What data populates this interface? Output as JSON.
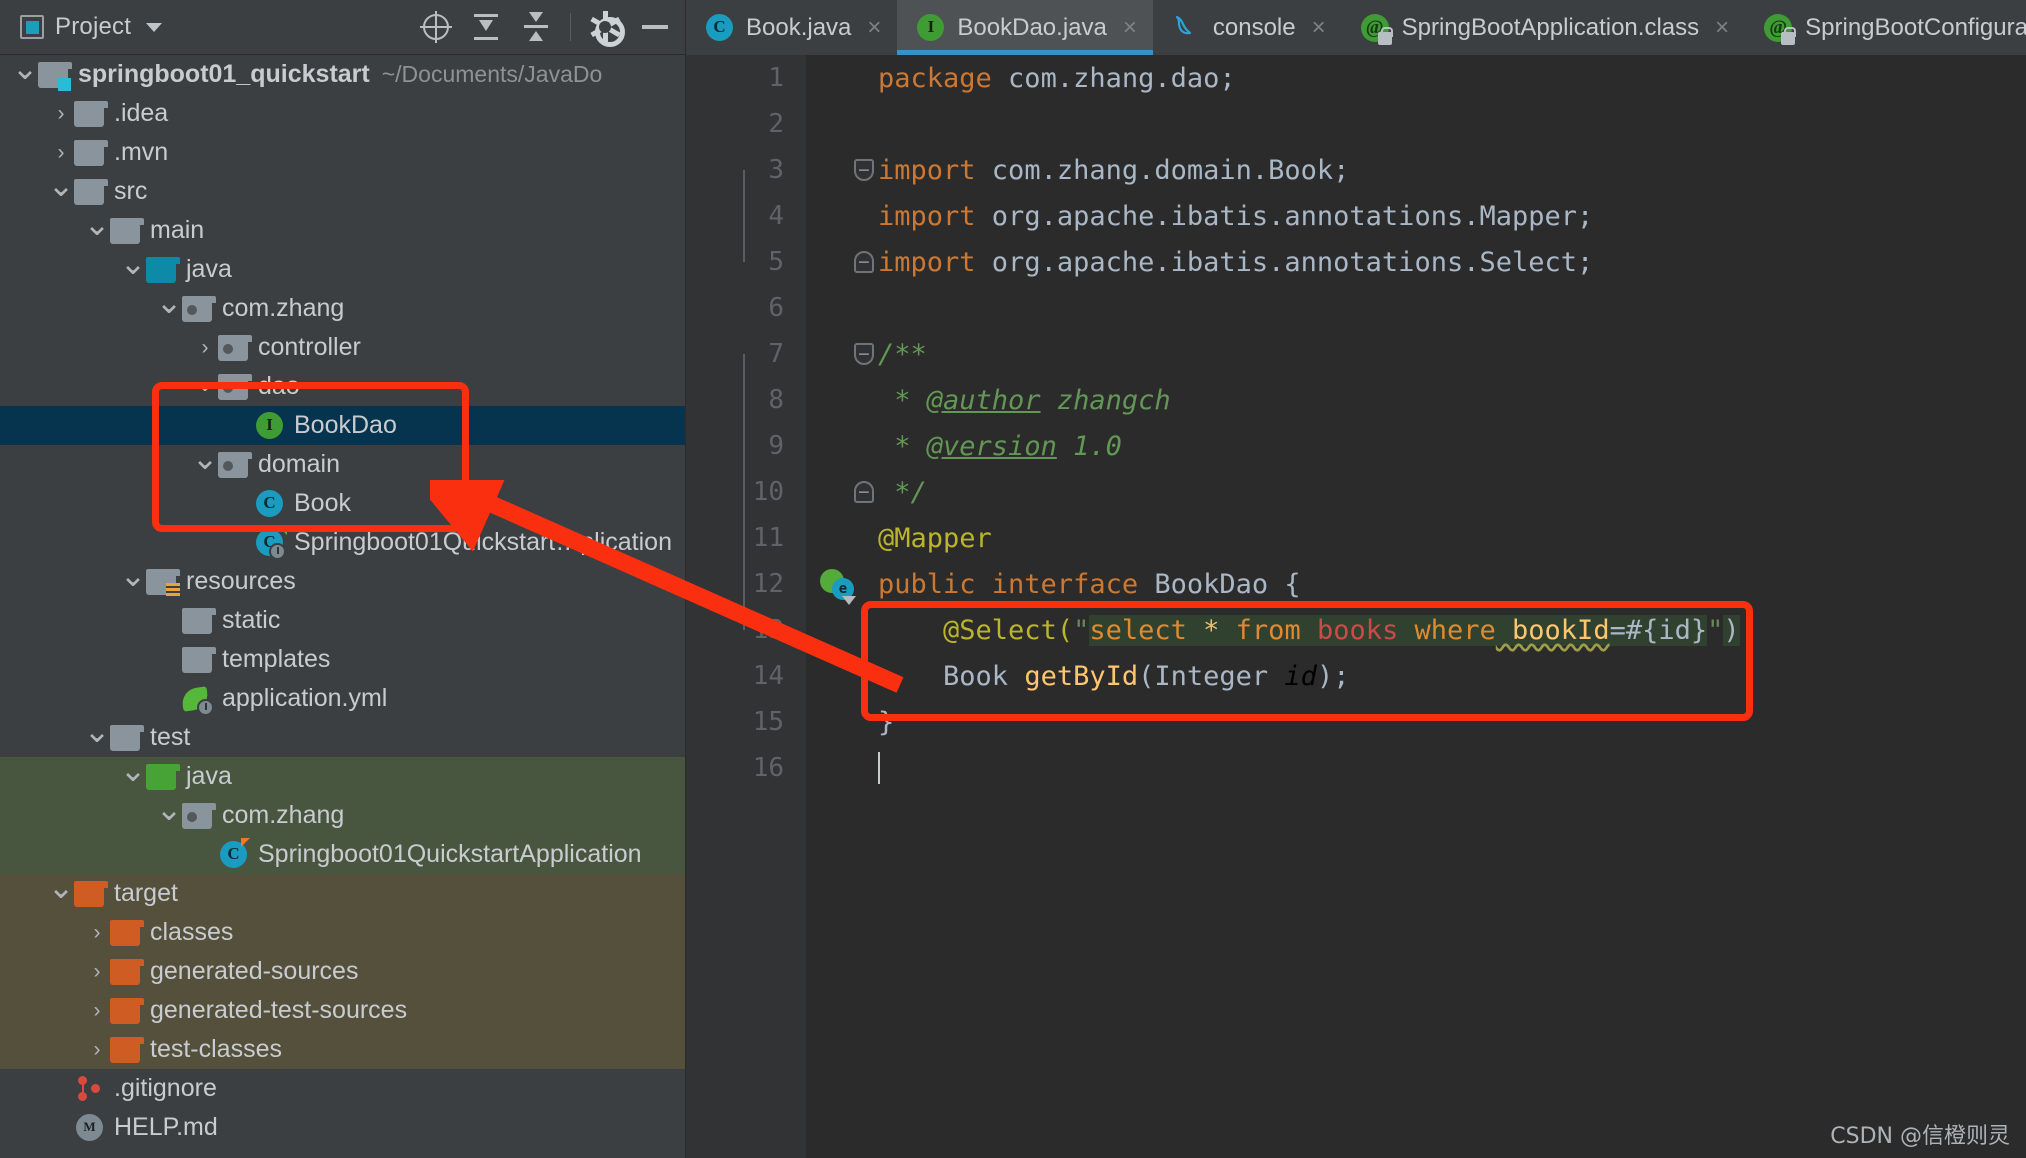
{
  "project_panel": {
    "title": "Project",
    "icons": {
      "dropdown": "chevron-down-icon",
      "locate": "locate-icon",
      "expand_all": "expand-all-icon",
      "collapse_all": "collapse-all-icon",
      "settings": "gear-icon",
      "hide": "minimize-icon"
    },
    "tree": [
      {
        "label": "springboot01_quickstart",
        "suffix": "~/Documents/JavaDo",
        "indent": 0,
        "arrow": "down",
        "icon": "module-folder",
        "bold": true
      },
      {
        "label": ".idea",
        "indent": 1,
        "arrow": "right",
        "icon": "folder"
      },
      {
        "label": ".mvn",
        "indent": 1,
        "arrow": "right",
        "icon": "folder"
      },
      {
        "label": "src",
        "indent": 1,
        "arrow": "down",
        "icon": "folder"
      },
      {
        "label": "main",
        "indent": 2,
        "arrow": "down",
        "icon": "folder"
      },
      {
        "label": "java",
        "indent": 3,
        "arrow": "down",
        "icon": "source-root-folder"
      },
      {
        "label": "com.zhang",
        "indent": 4,
        "arrow": "down",
        "icon": "package-folder"
      },
      {
        "label": "controller",
        "indent": 5,
        "arrow": "right",
        "icon": "package-folder"
      },
      {
        "label": "dao",
        "indent": 5,
        "arrow": "down",
        "icon": "package-folder"
      },
      {
        "label": "BookDao",
        "indent": 6,
        "arrow": "none",
        "icon": "interface-file",
        "selected": true
      },
      {
        "label": "domain",
        "indent": 5,
        "arrow": "down",
        "icon": "package-folder"
      },
      {
        "label": "Book",
        "indent": 6,
        "arrow": "none",
        "icon": "class-file"
      },
      {
        "label": "Springboot01Quickstart…plication",
        "indent": 6,
        "arrow": "none",
        "icon": "spring-boot-class-file"
      },
      {
        "label": "resources",
        "indent": 3,
        "arrow": "down",
        "icon": "resource-folder"
      },
      {
        "label": "static",
        "indent": 4,
        "arrow": "none",
        "icon": "folder"
      },
      {
        "label": "templates",
        "indent": 4,
        "arrow": "none",
        "icon": "folder"
      },
      {
        "label": "application.yml",
        "indent": 4,
        "arrow": "none",
        "icon": "spring-yaml-file"
      },
      {
        "label": "test",
        "indent": 2,
        "arrow": "down",
        "icon": "folder"
      },
      {
        "label": "java",
        "indent": 3,
        "arrow": "down",
        "icon": "test-source-root-folder",
        "rowbg": "test"
      },
      {
        "label": "com.zhang",
        "indent": 4,
        "arrow": "down",
        "icon": "package-folder",
        "rowbg": "test"
      },
      {
        "label": "Springboot01QuickstartApplication",
        "indent": 5,
        "arrow": "none",
        "icon": "test-class-file",
        "rowbg": "test"
      },
      {
        "label": "target",
        "indent": 1,
        "arrow": "down",
        "icon": "excluded-folder",
        "rowbg": "target"
      },
      {
        "label": "classes",
        "indent": 2,
        "arrow": "right",
        "icon": "excluded-folder",
        "rowbg": "target"
      },
      {
        "label": "generated-sources",
        "indent": 2,
        "arrow": "right",
        "icon": "excluded-folder",
        "rowbg": "target"
      },
      {
        "label": "generated-test-sources",
        "indent": 2,
        "arrow": "right",
        "icon": "excluded-folder",
        "rowbg": "target"
      },
      {
        "label": "test-classes",
        "indent": 2,
        "arrow": "right",
        "icon": "excluded-folder",
        "rowbg": "target"
      },
      {
        "label": ".gitignore",
        "indent": 1,
        "arrow": "none",
        "icon": "gitignore-file"
      },
      {
        "label": "HELP.md",
        "indent": 1,
        "arrow": "none",
        "icon": "markdown-file"
      }
    ]
  },
  "editor": {
    "tabs": [
      {
        "label": "Book.java",
        "icon": "class-file",
        "active": false,
        "closeable": true
      },
      {
        "label": "BookDao.java",
        "icon": "interface-file",
        "active": true,
        "closeable": true
      },
      {
        "label": "console",
        "icon": "mysql-dolphin-icon",
        "active": false,
        "closeable": true
      },
      {
        "label": "SpringBootApplication.class",
        "icon": "annotation-readonly-file",
        "active": false,
        "closeable": true
      },
      {
        "label": "SpringBootConfiguratio",
        "icon": "annotation-readonly-file",
        "active": false,
        "closeable": false
      }
    ],
    "file_name": "BookDao.java",
    "lines": [
      {
        "n": 1,
        "segments": [
          {
            "t": "package",
            "c": "kw"
          },
          {
            "t": " com.zhang.dao;",
            "c": "idf"
          }
        ]
      },
      {
        "n": 2,
        "segments": []
      },
      {
        "n": 3,
        "fold": "top",
        "segments": [
          {
            "t": "import",
            "c": "kw"
          },
          {
            "t": " com.zhang.domain.Book;",
            "c": "idf"
          }
        ]
      },
      {
        "n": 4,
        "segments": [
          {
            "t": "import",
            "c": "kw"
          },
          {
            "t": " org.apache.ibatis.annotations.Mapper;",
            "c": "idf"
          }
        ]
      },
      {
        "n": 5,
        "fold": "bot",
        "segments": [
          {
            "t": "import",
            "c": "kw"
          },
          {
            "t": " org.apache.ibatis.annotations.Select;",
            "c": "idf"
          }
        ]
      },
      {
        "n": 6,
        "segments": []
      },
      {
        "n": 7,
        "fold": "top",
        "segments": [
          {
            "t": "/**",
            "c": "cmt"
          }
        ]
      },
      {
        "n": 8,
        "segments": [
          {
            "t": " * ",
            "c": "cmt"
          },
          {
            "t": "@author",
            "c": "cmt u"
          },
          {
            "t": " zhangch",
            "c": "cmt"
          }
        ]
      },
      {
        "n": 9,
        "segments": [
          {
            "t": " * ",
            "c": "cmt"
          },
          {
            "t": "@version",
            "c": "cmt u"
          },
          {
            "t": " 1.0",
            "c": "cmt"
          }
        ]
      },
      {
        "n": 10,
        "fold": "bot",
        "segments": [
          {
            "t": " */",
            "c": "cmt"
          }
        ]
      },
      {
        "n": 11,
        "segments": [
          {
            "t": "@Mapper",
            "c": "ann"
          }
        ]
      },
      {
        "n": 12,
        "gutter_icon": "spring-bean-navigate-icon",
        "segments": [
          {
            "t": "public interface",
            "c": "kw"
          },
          {
            "t": " BookDao {",
            "c": "idf"
          }
        ]
      },
      {
        "n": 13,
        "segments": [
          {
            "t": "    ",
            "c": "idf"
          },
          {
            "t": "@Select(",
            "c": "ann"
          },
          {
            "t": "\"",
            "c": "str"
          },
          {
            "t": "select",
            "c": "sqlkw"
          },
          {
            "t": " * ",
            "c": "sqlstar"
          },
          {
            "t": "from",
            "c": "sqlkw"
          },
          {
            "t": " books ",
            "c": "sqltbl"
          },
          {
            "t": "where",
            "c": "sqlkw"
          },
          {
            "t": " bookId",
            "c": "sqlcol"
          },
          {
            "t": "=#{id}",
            "c": "idf"
          },
          {
            "t": "\"",
            "c": "str"
          },
          {
            "t": ")",
            "c": "idf"
          }
        ]
      },
      {
        "n": 14,
        "segments": [
          {
            "t": "    Book ",
            "c": "idf"
          },
          {
            "t": "getById",
            "c": "mth"
          },
          {
            "t": "(Integer ",
            "c": "idf"
          },
          {
            "t": "id",
            "c": "ital"
          },
          {
            "t": ");",
            "c": "idf"
          }
        ]
      },
      {
        "n": 15,
        "segments": [
          {
            "t": "}",
            "c": "idf"
          }
        ]
      },
      {
        "n": 16,
        "caret": true,
        "segments": []
      }
    ]
  },
  "annotations": {
    "tree_highlight_box": "red-rectangle-dao-domain",
    "code_highlight_box": "red-rectangle-select-method",
    "arrow": "red-arrow-pointing-to-tree"
  },
  "watermark": "CSDN @信橙则灵",
  "colors": {
    "panel_bg": "#3c3f41",
    "editor_bg": "#2b2b2b",
    "gutter_bg": "#313335",
    "selection": "#06344e",
    "tab_active": "#4e5254",
    "tab_underline": "#3592c4",
    "annotation_red": "#fa2f10",
    "keyword": "#cc7832",
    "identifier": "#a9b7c6",
    "comment": "#629755",
    "annotation_yellow": "#bbb529",
    "method": "#ffc66d",
    "sql_injection_bg": "#31412f"
  }
}
